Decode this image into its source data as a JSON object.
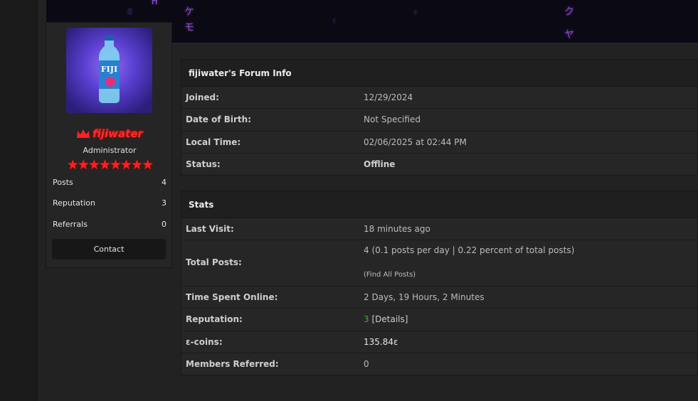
{
  "profile": {
    "username": "fijiwater",
    "role": "Administrator",
    "stars": "★★★★★★★★",
    "stats": [
      {
        "label": "Posts",
        "value": "4"
      },
      {
        "label": "Reputation",
        "value": "3"
      },
      {
        "label": "Referrals",
        "value": "0"
      }
    ],
    "contact_label": "Contact",
    "avatar_brand": "FIJI",
    "crown_icon": "crown-icon",
    "accent_color": "#ff2b2b"
  },
  "forum_info": {
    "title": "fijiwater's Forum Info",
    "rows": [
      {
        "label": "Joined:",
        "value": "12/29/2024"
      },
      {
        "label": "Date of Birth:",
        "value": "Not Specified"
      },
      {
        "label": "Local Time:",
        "value": "02/06/2025 at 02:44 PM"
      },
      {
        "label": "Status:",
        "value": "Offline"
      }
    ]
  },
  "stats": {
    "title": "Stats",
    "last_visit_label": "Last Visit:",
    "last_visit_value": "18 minutes ago",
    "total_posts_label": "Total Posts:",
    "total_posts_value": "4 (0.1 posts per day | 0.22 percent of total posts)",
    "find_all_open": "(",
    "find_all_label": "Find All Posts",
    "find_all_close": ")",
    "time_online_label": "Time Spent Online:",
    "time_online_value": "2 Days, 19 Hours, 2 Minutes",
    "reputation_label": "Reputation:",
    "reputation_value": "3",
    "reputation_details_open": "[",
    "reputation_details_label": "Details",
    "reputation_details_close": "]",
    "coins_label": "ε-coins:",
    "coins_value": "135.84ε",
    "referred_label": "Members Referred:",
    "referred_value": "0"
  },
  "banner": {
    "glyphs": [
      "H",
      "ミ",
      "ケ",
      "モ",
      "ク",
      "ヤ",
      "ｨ",
      "ｯ"
    ]
  }
}
